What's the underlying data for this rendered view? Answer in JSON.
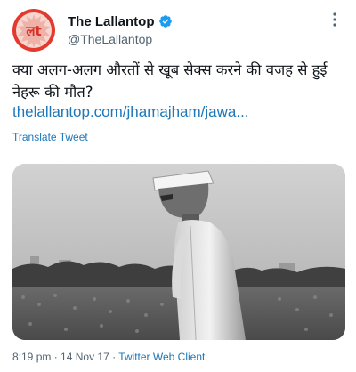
{
  "tweet": {
    "author": {
      "display_name": "The Lallantop",
      "handle": "@TheLallantop",
      "verified": true,
      "avatar_text": "लt"
    },
    "text_line1": "क्या अलग-अलग औरतों से खूब सेक्स करने की वजह से हुई",
    "text_line2": "नेहरू की मौत?",
    "link": "thelallantop.com/jhamajham/jawa...",
    "translate_label": "Translate Tweet",
    "time": "8:19 pm",
    "date": "14 Nov 17",
    "separator": "·",
    "client": "Twitter Web Client"
  },
  "colors": {
    "link": "#1d77b8",
    "verified": "#1d9bf0",
    "avatar_brand": "#e23a2e"
  }
}
